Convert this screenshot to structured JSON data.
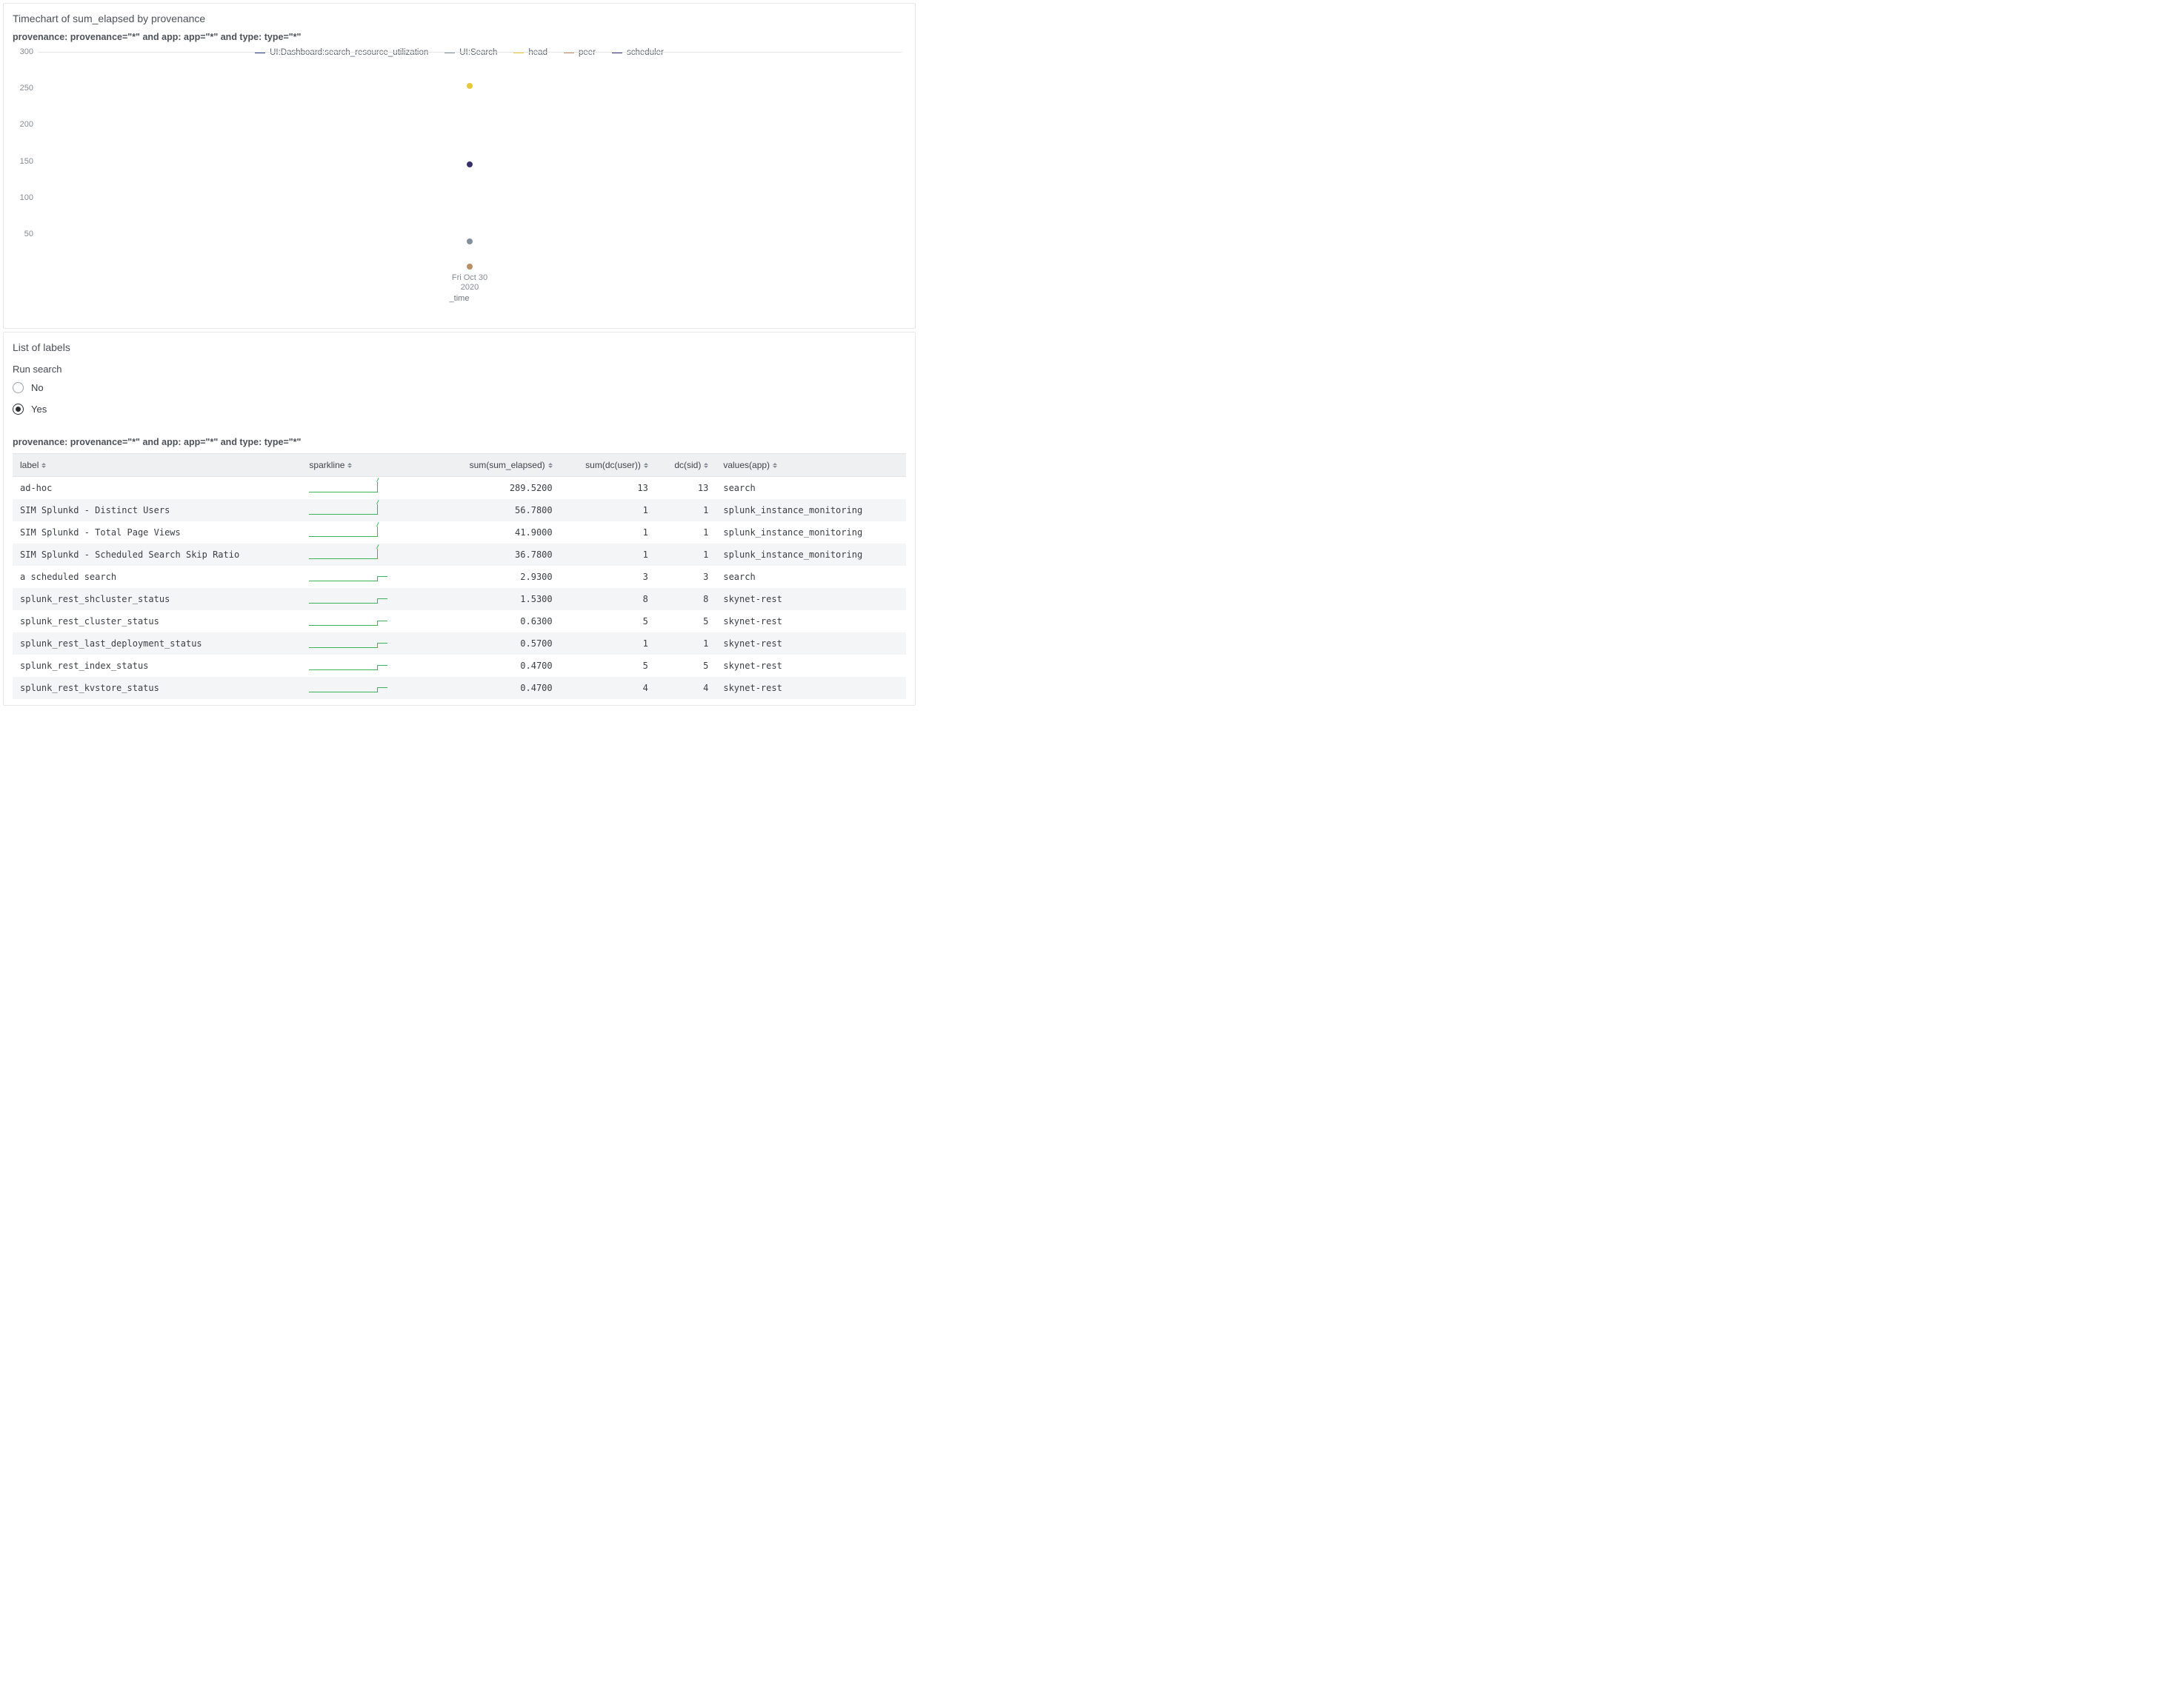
{
  "chart_panel": {
    "title": "Timechart of sum_elapsed by provenance",
    "subtitle": "provenance: provenance=\"*\" and app: app=\"*\" and type: type=\"*\"",
    "xlabel": "_time",
    "x_tick_line1": "Fri Oct 30",
    "x_tick_line2": "2020"
  },
  "chart_data": {
    "type": "scatter",
    "title": "Timechart of sum_elapsed by provenance",
    "xlabel": "_time",
    "ylabel": "",
    "ylim": [
      0,
      300
    ],
    "yticks": [
      50,
      100,
      150,
      200,
      250,
      300
    ],
    "x": [
      "Fri Oct 30 2020"
    ],
    "series": [
      {
        "name": "UI:Dashboard:search_resource_utilization",
        "color": "#2b3a7a",
        "values": [
          null
        ]
      },
      {
        "name": "UI:Search",
        "color": "#82909e",
        "values": [
          40
        ]
      },
      {
        "name": "head",
        "color": "#e5c93a",
        "values": [
          253
        ]
      },
      {
        "name": "peer",
        "color": "#b98f63",
        "values": [
          5
        ]
      },
      {
        "name": "scheduler",
        "color": "#35316c",
        "values": [
          145
        ]
      }
    ]
  },
  "chart_points": [
    {
      "series_index": 2,
      "y": 253
    },
    {
      "series_index": 4,
      "y": 145
    },
    {
      "series_index": 1,
      "y": 40
    },
    {
      "series_index": 3,
      "y": 5
    }
  ],
  "labels_panel": {
    "title": "List of labels",
    "field_label": "Run search",
    "options": [
      {
        "label": "No",
        "selected": false
      },
      {
        "label": "Yes",
        "selected": true
      }
    ],
    "subtitle": "provenance: provenance=\"*\" and app: app=\"*\" and type: type=\"*\""
  },
  "table": {
    "columns": [
      {
        "key": "label",
        "label": "label",
        "align": "left",
        "sortable": true
      },
      {
        "key": "sparkline",
        "label": "sparkline",
        "align": "left",
        "sortable": true
      },
      {
        "key": "sum_sum_elapsed",
        "label": "sum(sum_elapsed)",
        "align": "right",
        "sortable": true
      },
      {
        "key": "sum_dc_user",
        "label": "sum(dc(user))",
        "align": "right",
        "sortable": true
      },
      {
        "key": "dc_sid",
        "label": "dc(sid)",
        "align": "right",
        "sortable": true
      },
      {
        "key": "values_app",
        "label": "values(app)",
        "align": "left",
        "sortable": true
      }
    ],
    "rows": [
      {
        "label": "ad-hoc",
        "sum_sum_elapsed": "289.5200",
        "sum_dc_user": "13",
        "dc_sid": "13",
        "values_app": "search",
        "sparkshape": "spike"
      },
      {
        "label": "SIM Splunkd - Distinct Users",
        "sum_sum_elapsed": "56.7800",
        "sum_dc_user": "1",
        "dc_sid": "1",
        "values_app": "splunk_instance_monitoring",
        "sparkshape": "spike"
      },
      {
        "label": "SIM Splunkd - Total Page Views",
        "sum_sum_elapsed": "41.9000",
        "sum_dc_user": "1",
        "dc_sid": "1",
        "values_app": "splunk_instance_monitoring",
        "sparkshape": "spike"
      },
      {
        "label": "SIM Splunkd - Scheduled Search Skip Ratio",
        "sum_sum_elapsed": "36.7800",
        "sum_dc_user": "1",
        "dc_sid": "1",
        "values_app": "splunk_instance_monitoring",
        "sparkshape": "spike"
      },
      {
        "label": "a scheduled search",
        "sum_sum_elapsed": "2.9300",
        "sum_dc_user": "3",
        "dc_sid": "3",
        "values_app": "search",
        "sparkshape": "step"
      },
      {
        "label": "splunk_rest_shcluster_status",
        "sum_sum_elapsed": "1.5300",
        "sum_dc_user": "8",
        "dc_sid": "8",
        "values_app": "skynet-rest",
        "sparkshape": "step"
      },
      {
        "label": "splunk_rest_cluster_status",
        "sum_sum_elapsed": "0.6300",
        "sum_dc_user": "5",
        "dc_sid": "5",
        "values_app": "skynet-rest",
        "sparkshape": "step"
      },
      {
        "label": "splunk_rest_last_deployment_status",
        "sum_sum_elapsed": "0.5700",
        "sum_dc_user": "1",
        "dc_sid": "1",
        "values_app": "skynet-rest",
        "sparkshape": "step"
      },
      {
        "label": "splunk_rest_index_status",
        "sum_sum_elapsed": "0.4700",
        "sum_dc_user": "5",
        "dc_sid": "5",
        "values_app": "skynet-rest",
        "sparkshape": "step"
      },
      {
        "label": "splunk_rest_kvstore_status",
        "sum_sum_elapsed": "0.4700",
        "sum_dc_user": "4",
        "dc_sid": "4",
        "values_app": "skynet-rest",
        "sparkshape": "step"
      }
    ]
  }
}
